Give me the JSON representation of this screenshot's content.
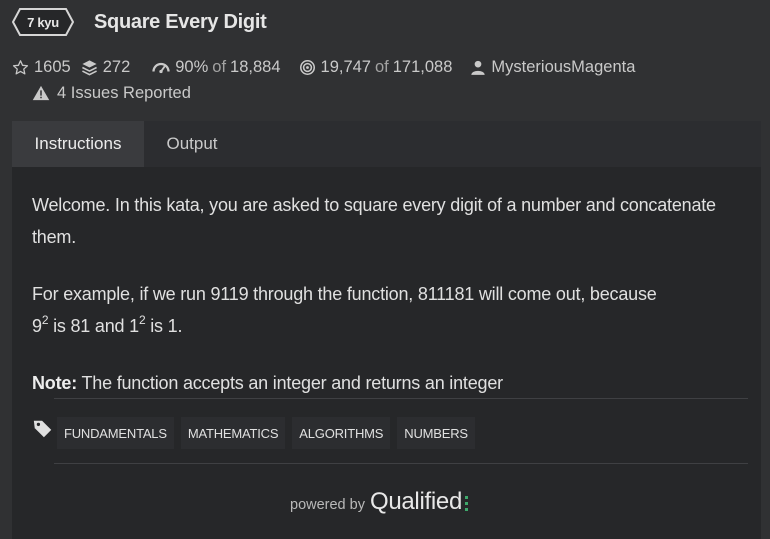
{
  "kata": {
    "rank": "7 kyu",
    "title": "Square Every Digit"
  },
  "stats": {
    "stars": "1605",
    "collections": "272",
    "satisfaction_percent": "90%",
    "satisfaction_of": "of",
    "satisfaction_total": "18,884",
    "completed": "19,747",
    "completed_of": "of",
    "attempts_total": "171,088",
    "author": "MysteriousMagenta",
    "issues": "4 Issues Reported"
  },
  "tabs": [
    {
      "label": "Instructions",
      "active": true
    },
    {
      "label": "Output",
      "active": false
    }
  ],
  "description": {
    "p1": "Welcome. In this kata, you are asked to square every digit of a number and concatenate them.",
    "p2_a": "For example, if we run 9119 through the function, 811181 will come out, because",
    "p2_b": "9",
    "p2_sup1": "2",
    "p2_c": " is 81 and 1",
    "p2_sup2": "2",
    "p2_d": " is 1.",
    "note_label": "Note:",
    "note_text": " The function accepts an integer and returns an integer"
  },
  "tags": [
    "FUNDAMENTALS",
    "MATHEMATICS",
    "ALGORITHMS",
    "NUMBERS"
  ],
  "footer": {
    "powered_by": "powered by",
    "brand": "Qualified"
  },
  "colors": {
    "background": "#303133",
    "panel": "#262729",
    "brand_accent": "#3ea86b"
  }
}
